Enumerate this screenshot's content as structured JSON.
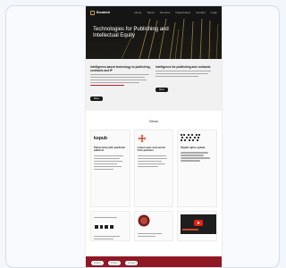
{
  "nav": {
    "logo_text": "Euratech",
    "items": [
      "Home",
      "Topics",
      "Services",
      "Organization",
      "Contact",
      "Login"
    ]
  },
  "hero": {
    "title": "Technologies for Publishing and Intellectual Equity"
  },
  "intro": {
    "left_heading": "Intelligence-based technology to publishing, contracts and IP",
    "right_heading": "Intelligence for publishing and contracts",
    "button_label": "More"
  },
  "news": {
    "section_title": "News",
    "tiles": [
      {
        "logo": "kopub",
        "heading": "Partnership with publisher platform"
      },
      {
        "logo": "red-flower-icon",
        "heading": "Latest news and events from partners"
      },
      {
        "logo": "qr-grid-icon",
        "heading": "Digital rights update"
      }
    ]
  },
  "footer": {
    "links": [
      "Imprint",
      "Privacy",
      "Contact"
    ]
  },
  "colors": {
    "accent_red": "#8f1824",
    "hero_gold": "#c6a24a",
    "nav_dark": "#151515"
  }
}
